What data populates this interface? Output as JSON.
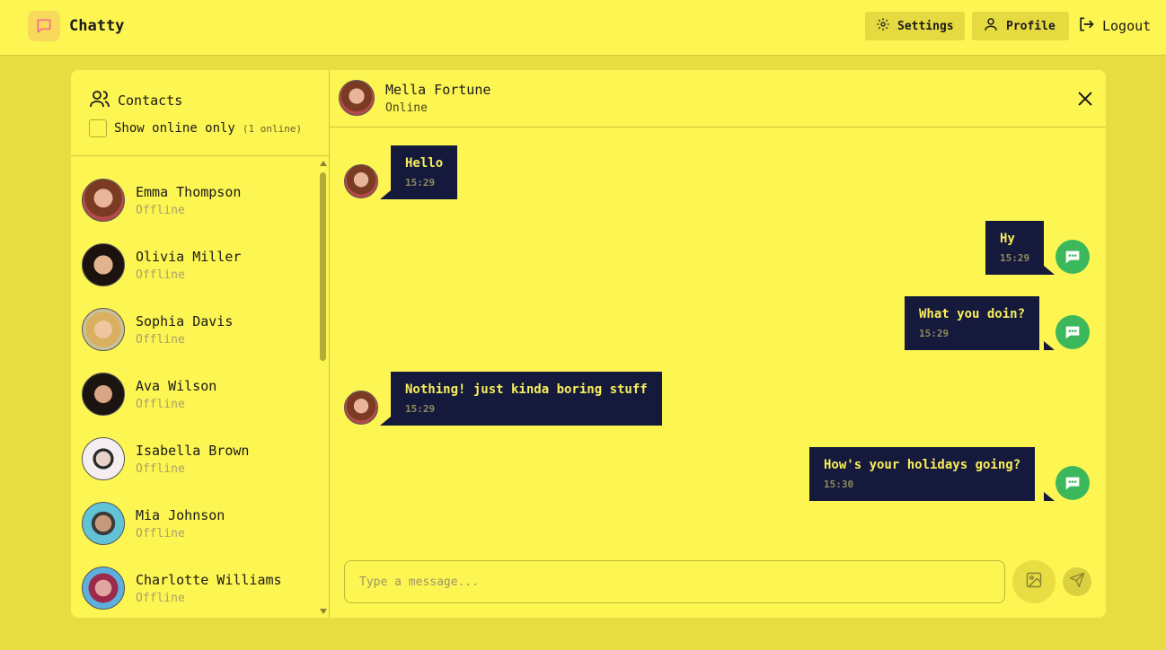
{
  "app": {
    "name": "Chatty",
    "nav": {
      "settings": "Settings",
      "profile": "Profile",
      "logout": "Logout"
    }
  },
  "sidebar": {
    "title": "Contacts",
    "filter_label": "Show online only",
    "online_count": "(1 online)",
    "contacts": [
      {
        "name": "Emma Thompson",
        "status": "Offline"
      },
      {
        "name": "Olivia Miller",
        "status": "Offline"
      },
      {
        "name": "Sophia Davis",
        "status": "Offline"
      },
      {
        "name": "Ava Wilson",
        "status": "Offline"
      },
      {
        "name": "Isabella Brown",
        "status": "Offline"
      },
      {
        "name": "Mia Johnson",
        "status": "Offline"
      },
      {
        "name": "Charlotte Williams",
        "status": "Offline"
      }
    ]
  },
  "chat": {
    "contact_name": "Mella Fortune",
    "contact_status": "Online",
    "messages": [
      {
        "text": "Hello",
        "time": "15:29",
        "direction": "received"
      },
      {
        "text": "Hy",
        "time": "15:29",
        "direction": "sent"
      },
      {
        "text": "What you doin?",
        "time": "15:29",
        "direction": "sent"
      },
      {
        "text": "Nothing! just kinda boring stuff",
        "time": "15:29",
        "direction": "received"
      },
      {
        "text": "How's your holidays going?",
        "time": "15:30",
        "direction": "sent"
      }
    ],
    "composer": {
      "placeholder": "Type a message...",
      "value": ""
    }
  },
  "colors": {
    "background": "#e7dc40",
    "surface": "#fdf551",
    "bubble": "#151a3d",
    "bubble_text": "#f8ee5a",
    "sent_icon": "#3cb85c",
    "logo_accent": "#f26d8d"
  },
  "icons": {
    "logo": "message-square-icon",
    "settings": "gear-icon",
    "profile": "user-icon",
    "logout": "logout-icon",
    "contacts": "users-icon",
    "close": "close-icon",
    "image": "image-icon",
    "send": "send-icon",
    "sent_marker": "chat-bubble-dots-icon"
  }
}
